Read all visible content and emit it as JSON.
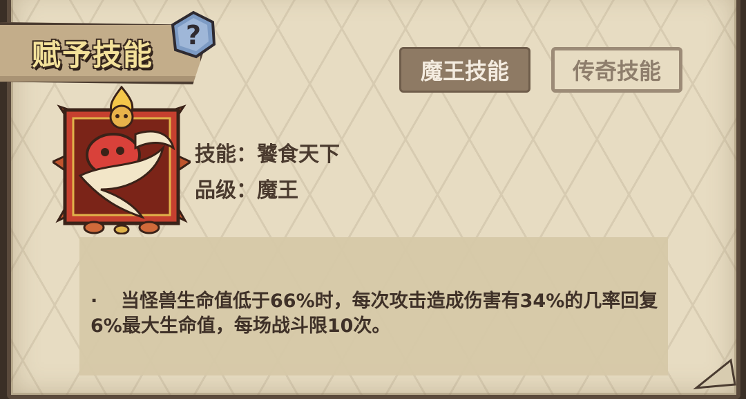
{
  "panel": {
    "title": "赋予技能",
    "help_symbol": "?"
  },
  "tabs": [
    {
      "label": "魔王技能",
      "active": true
    },
    {
      "label": "传奇技能",
      "active": false
    }
  ],
  "skill": {
    "icon": "flaming-red-mushroom-skill-icon",
    "name_line": "技能：饕食天下",
    "grade_line": "品级：魔王"
  },
  "description": {
    "bullet": "·",
    "text": "当怪兽生命值低于66%时，每次攻击造成伤害有34%的几率回复6%最大生命值，每场战斗限10次。"
  },
  "colors": {
    "parchment": "#e7dcc2",
    "title_text": "#f3e19a",
    "tab_active_bg": "#8e7a64",
    "help_badge": "#7d9bc4"
  }
}
